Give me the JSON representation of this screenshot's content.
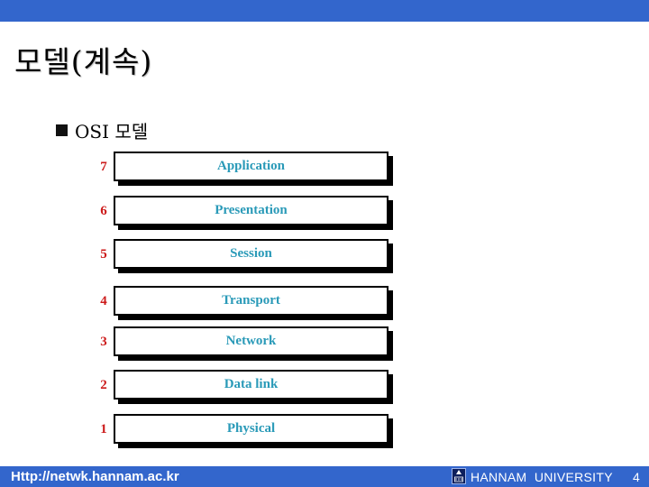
{
  "header": {
    "bar_color": "#3366cc"
  },
  "slide": {
    "title": "모델(계속)",
    "bullet_text": "OSI 모델"
  },
  "osi_layers": [
    {
      "number": "7",
      "name": "Application"
    },
    {
      "number": "6",
      "name": "Presentation"
    },
    {
      "number": "5",
      "name": "Session"
    },
    {
      "number": "4",
      "name": "Transport"
    },
    {
      "number": "3",
      "name": "Network"
    },
    {
      "number": "2",
      "name": "Data link"
    },
    {
      "number": "1",
      "name": "Physical"
    }
  ],
  "colors": {
    "layer_number": "#cc1a1a",
    "layer_label": "#2a9ab8",
    "bar": "#3366cc"
  },
  "footer": {
    "url": "Http://netwk.hannam.ac.kr",
    "logo_icon": "hannam-university-logo-icon",
    "university": "HANNAM  UNIVERSITY",
    "page_number": "4"
  }
}
